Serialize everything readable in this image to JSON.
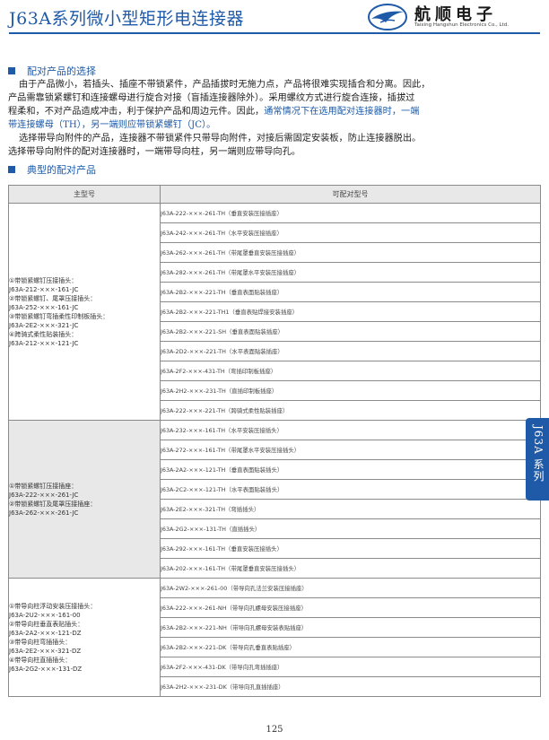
{
  "header": {
    "title": "J63A系列微小型矩形电连接器",
    "brand_cn": "航顺电子",
    "brand_en": "Taixing Hangshun Electronics Co., Ltd.",
    "accent_color": "#1e5aa8",
    "logo_icon": "swallow-logo-icon"
  },
  "section1": {
    "heading": "配对产品的选择",
    "lines": [
      "由于产品微小，若插头、插座不带锁紧件，产品插拔时无施力点，产品将很难实现插合和分离。因此，",
      "产品需靠锁紧螺钉和连接螺母进行旋合对接（盲插连接器除外）。采用螺纹方式进行旋合连接，插拔过",
      "程柔和，不对产品造成冲击，利于保护产品和周边元件。因此，",
      "带连接螺母（TH），另一端则应带锁紧螺钉（JC）。",
      "选择带导向附件的产品，连接器不带锁紧件只带导向附件，对接后需固定安装板，防止连接器脱出。",
      "选择带导向附件的配对连接器时，一端带导向柱，另一端则应带导向孔。"
    ],
    "highlight_end_line3": "通常情况下在选用配对连接器时，一端"
  },
  "section2": {
    "heading": "典型的配对产品"
  },
  "table": {
    "col_main": "主型号",
    "col_pair": "可配对型号",
    "groups": [
      {
        "main_lines": [
          "①带锁紧螺钉压接插头：",
          "J63A-212-×××-161-JC",
          "②带锁紧螺钉、尾罩压接插头：",
          "J63A-252-×××-161-JC",
          "③带锁紧螺钉弯插柔性印制板插头：",
          "J63A-2E2-×××-321-JC",
          "④跨骑式柔性贴装插头：",
          "J63A-212-×××-121-JC"
        ],
        "pairs": [
          "J63A-222-×××-261-TH（垂直安装压接插座）",
          "J63A-242-×××-261-TH（水平安装压接插座）",
          "J63A-262-×××-261-TH（带尾罩垂直安装压接插座）",
          "J63A-282-×××-261-TH（带尾罩水平安装压接插座）",
          "J63A-2B2-×××-221-TH（垂直表面贴装插座）",
          "J63A-2B2-×××-221-TH1（垂直表贴焊接安装插座）",
          "J63A-2B2-×××-221-SH（垂直表面贴装插座）",
          "J63A-2D2-×××-221-TH（水平表面贴装插座）",
          "J63A-2F2-×××-431-TH（弯插印制板插座）",
          "J63A-2H2-×××-231-TH（直插印制板插座）",
          "J63A-222-×××-221-TH（跨骑式柔性贴装插座）"
        ]
      },
      {
        "main_lines": [
          "①带锁紧螺钉压接插座：",
          "J63A-222-×××-261-JC",
          "②带锁紧螺钉及尾罩压接插座：",
          "J63A-262-×××-261-JC"
        ],
        "pairs": [
          "J63A-232-×××-161-TH（水平安装压接插头）",
          "J63A-272-×××-161-TH（带尾罩水平安装压接插头）",
          "J63A-2A2-×××-121-TH（垂直表面贴装插头）",
          "J63A-2C2-×××-121-TH（水平表面贴装插头）",
          "J63A-2E2-×××-321-TH（弯插插头）",
          "J63A-2G2-×××-131-TH（直插插头）",
          "J63A-292-×××-161-TH（垂直安装压接插头）",
          "J63A-202-×××-161-TH（带尾罩垂直安装压接插头）"
        ]
      },
      {
        "main_lines": [
          "①带导向柱浮动安装压接插头：",
          "J63A-2U2-×××-161-00",
          "②带导向柱垂直表贴插头：",
          "J63A-2A2-×××-121-DZ",
          "③带导向柱弯插插头：",
          "J63A-2E2-×××-321-DZ",
          "④带导向柱直插插头：",
          "J63A-2G2-×××-131-DZ"
        ],
        "pairs": [
          "J63A-2W2-×××-261-00（带导向孔法兰安装压接插座）",
          "J63A-222-×××-261-NH（带导向孔螺母安装压接插座）",
          "J63A-2B2-×××-221-NH（带导向孔螺母安装表贴插座）",
          "J63A-2B2-×××-221-DK（带导向孔垂直表贴插座）",
          "J63A-2F2-×××-431-DK（带导向孔弯插插座）",
          "J63A-2H2-×××-231-DK（带导向孔直插插座）"
        ]
      }
    ]
  },
  "side_tab": "J63A 系列",
  "page_number": "125"
}
